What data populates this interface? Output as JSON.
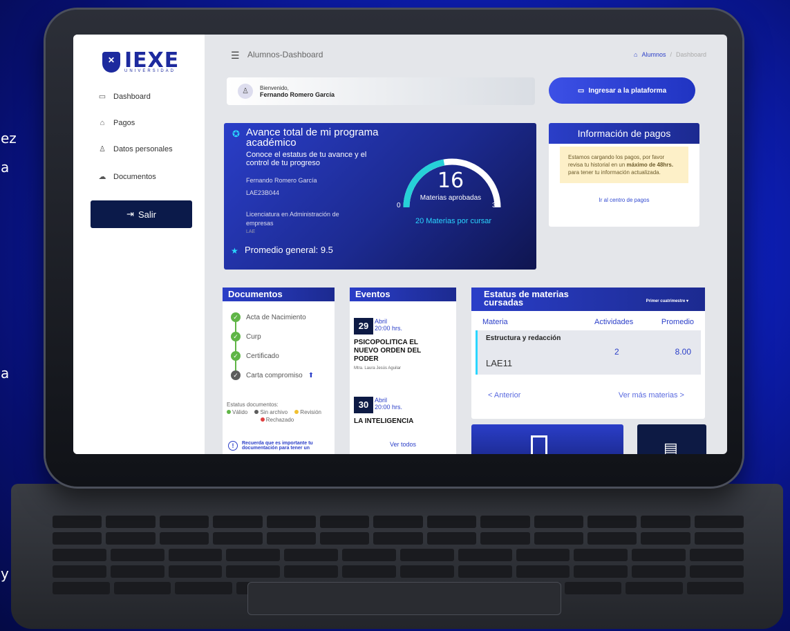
{
  "side_fragments": [
    "ez",
    "a",
    "a",
    "y"
  ],
  "sidebar": {
    "brand": "IEXE",
    "brand_sub": "UNIVERSIDAD",
    "items": [
      {
        "label": "Dashboard",
        "icon": "calendar-icon"
      },
      {
        "label": "Pagos",
        "icon": "bank-icon"
      },
      {
        "label": "Datos personales",
        "icon": "user-icon"
      },
      {
        "label": "Documentos",
        "icon": "cloud-icon"
      }
    ],
    "logout": "Salir"
  },
  "topbar": {
    "title": "Alumnos-Dashboard",
    "crumbs": [
      "Alumnos",
      "Dashboard"
    ]
  },
  "welcome": {
    "greeting": "Bienvenido,",
    "name": "Fernando Romero García"
  },
  "ingresar_label": "Ingresar a la plataforma",
  "avance": {
    "title": "Avance total de mi programa académico",
    "desc": "Conoce el estatus de tu avance y el control de tu progreso",
    "student": "Fernando Romero García",
    "id": "LAE23B044",
    "program": "Licenciatura en Administración de empresas",
    "program_code": "LAE",
    "promedio": "Promedio general: 9.5",
    "gauge": {
      "value": "16",
      "label": "Materias aprobadas",
      "min": "0",
      "max": "36",
      "remaining": "20 Materias por cursar",
      "fraction": 0.444
    }
  },
  "pagos": {
    "title": "Información de pagos",
    "msg_a": "Estamos cargando los pagos, por favor revisa tu historial en un ",
    "msg_b": "máximo de 48hrs.",
    "msg_c": " para tener tu información actualizada.",
    "link": "Ir al centro de pagos"
  },
  "documentos": {
    "title": "Documentos",
    "items": [
      "Acta de Nacimiento",
      "Curp",
      "Certificado",
      "Carta compromiso"
    ],
    "status_label": "Estatus documentos:",
    "legend": [
      "Válido",
      "Sin archivo",
      "Revisión",
      "Rechazado"
    ],
    "colors": [
      "#5fb546",
      "#5c5c5c",
      "#f0c030",
      "#e04040"
    ],
    "reminder": "Recuerda que es importante tu documentación para tener un"
  },
  "eventos": {
    "title": "Eventos",
    "items": [
      {
        "day": "29",
        "month": "Abril",
        "time": "20:00 hrs.",
        "title": "PSICOPOLITICA EL NUEVO ORDEN DEL PODER",
        "by": "Mtra. Laura Jesús Aguilar"
      },
      {
        "day": "30",
        "month": "Abril",
        "time": "20:00 hrs.",
        "title": "LA INTELIGENCIA",
        "by": ""
      }
    ],
    "ver_todos": "Ver todos"
  },
  "estatus": {
    "title": "Estatus de materias cursadas",
    "filter": "Primer cuatrimestre",
    "cols": [
      "Materia",
      "Actividades",
      "Promedio"
    ],
    "row": {
      "name": "Estructura y redacción",
      "code": "LAE11",
      "actividades": "2",
      "promedio": "8.00"
    },
    "prev": "< Anterior",
    "next": "Ver más materias >"
  }
}
